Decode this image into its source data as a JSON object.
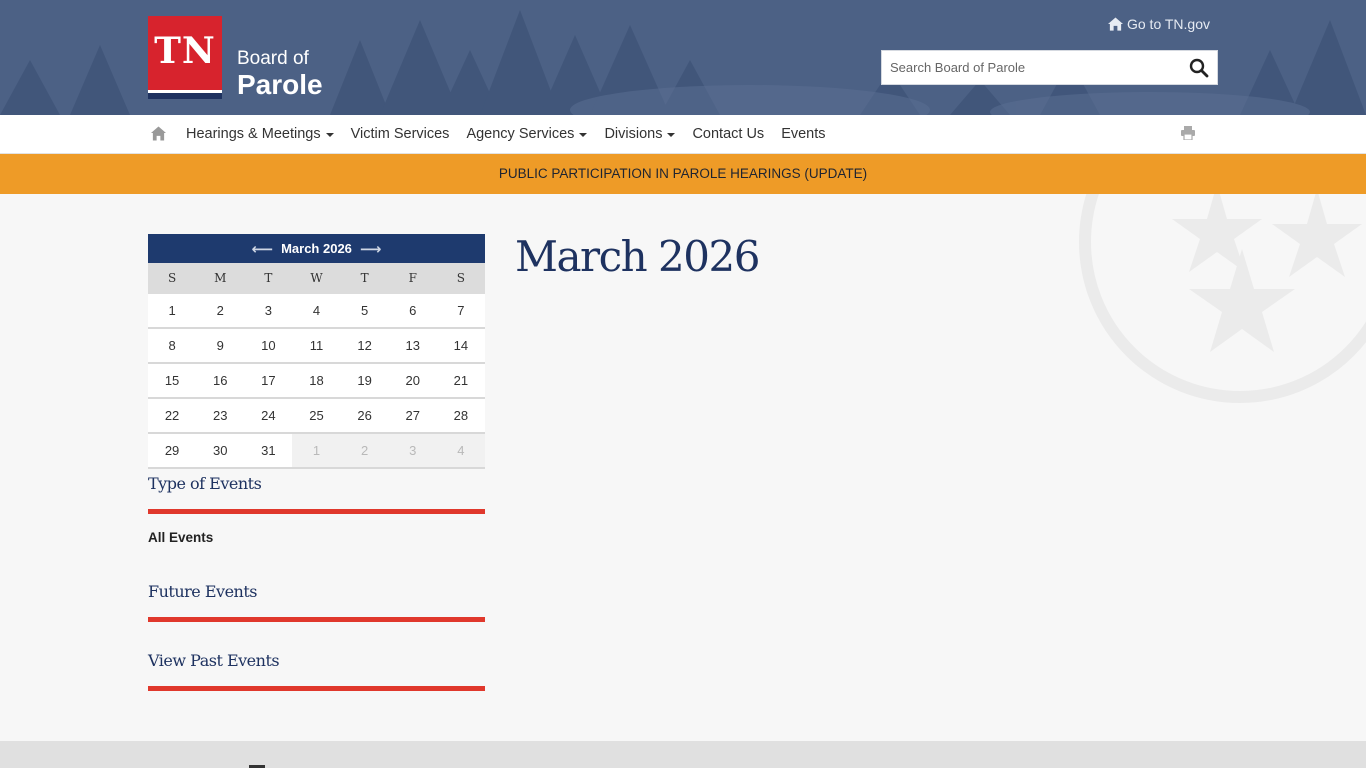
{
  "header": {
    "logo_tn": "TN",
    "logo_line1": "Board of",
    "logo_line2": "Parole",
    "goto_label": "Go to TN.gov",
    "search_placeholder": "Search Board of Parole"
  },
  "nav": {
    "items": [
      {
        "label": "Hearings & Meetings",
        "dropdown": true
      },
      {
        "label": "Victim Services",
        "dropdown": false
      },
      {
        "label": "Agency Services",
        "dropdown": true
      },
      {
        "label": "Divisions",
        "dropdown": true
      },
      {
        "label": "Contact Us",
        "dropdown": false
      },
      {
        "label": "Events",
        "dropdown": false
      }
    ]
  },
  "alert": {
    "text": "PUBLIC PARTICIPATION IN PAROLE HEARINGS (UPDATE)"
  },
  "calendar": {
    "month_label": "March 2026",
    "weekdays": [
      "S",
      "M",
      "T",
      "W",
      "T",
      "F",
      "S"
    ],
    "weeks": [
      [
        "1",
        "2",
        "3",
        "4",
        "5",
        "6",
        "7"
      ],
      [
        "8",
        "9",
        "10",
        "11",
        "12",
        "13",
        "14"
      ],
      [
        "15",
        "16",
        "17",
        "18",
        "19",
        "20",
        "21"
      ],
      [
        "22",
        "23",
        "24",
        "25",
        "26",
        "27",
        "28"
      ],
      [
        "29",
        "30",
        "31",
        "1",
        "2",
        "3",
        "4"
      ]
    ],
    "other_month_days_last_week": 4
  },
  "sidebar": {
    "type_heading": "Type of Events",
    "all_events": "All Events",
    "future_heading": "Future Events",
    "past_heading": "View Past Events"
  },
  "main": {
    "title": "March 2026"
  },
  "colors": {
    "header_bg": "#4c6185",
    "brand_red": "#d7232d",
    "brand_navy": "#1e3260",
    "alert_orange": "#ee9b27",
    "accent_line": "#e0382c"
  }
}
